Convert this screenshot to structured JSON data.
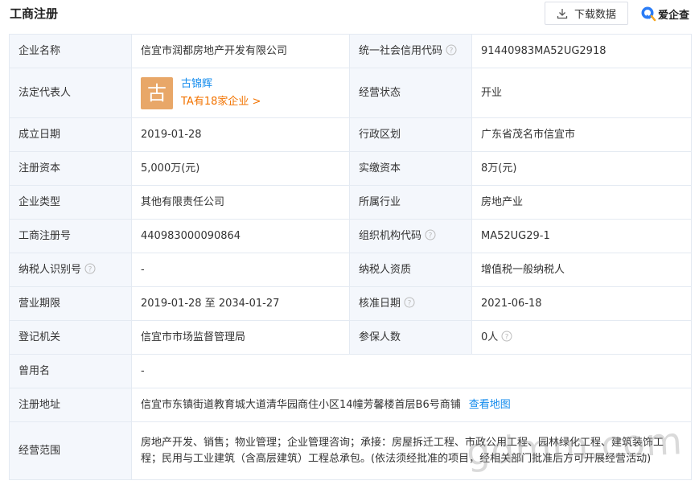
{
  "header": {
    "title": "工商注册",
    "download_label": "下载数据",
    "brand_name": "爱企查"
  },
  "rows": {
    "company_name": {
      "label": "企业名称",
      "value": "信宜市润都房地产开发有限公司"
    },
    "credit_code": {
      "label": "统一社会信用代码",
      "value": "91440983MA52UG2918"
    },
    "legal_rep": {
      "label": "法定代表人",
      "avatar_char": "古",
      "name": "古锦辉",
      "note": "TA有18家企业 >"
    },
    "status": {
      "label": "经营状态",
      "value": "开业"
    },
    "founded": {
      "label": "成立日期",
      "value": "2019-01-28"
    },
    "region": {
      "label": "行政区划",
      "value": "广东省茂名市信宜市"
    },
    "reg_capital": {
      "label": "注册资本",
      "value": "5,000万(元)"
    },
    "paid_capital": {
      "label": "实缴资本",
      "value": "8万(元)"
    },
    "company_type": {
      "label": "企业类型",
      "value": "其他有限责任公司"
    },
    "industry": {
      "label": "所属行业",
      "value": "房地产业"
    },
    "reg_number": {
      "label": "工商注册号",
      "value": "440983000090864"
    },
    "org_code": {
      "label": "组织机构代码",
      "value": "MA52UG29-1"
    },
    "taxpayer_id": {
      "label": "纳税人识别号",
      "value": "-"
    },
    "taxpayer_qual": {
      "label": "纳税人资质",
      "value": "增值税一般纳税人"
    },
    "term": {
      "label": "营业期限",
      "value": "2019-01-28 至 2034-01-27"
    },
    "approval_date": {
      "label": "核准日期",
      "value": "2021-06-18"
    },
    "authority": {
      "label": "登记机关",
      "value": "信宜市市场监督管理局"
    },
    "insured": {
      "label": "参保人数",
      "value": "0人"
    },
    "former_name": {
      "label": "曾用名",
      "value": "-"
    },
    "address": {
      "label": "注册地址",
      "value": "信宜市东镇街道教育城大道清华园商住小区14幢芳馨楼首层B6号商铺",
      "map_link": "查看地图"
    },
    "scope": {
      "label": "经营范围",
      "value": "房地产开发、销售；物业管理；企业管理咨询；承接：房屋拆迁工程、市政公用工程、园林绿化工程、建筑装饰工程；民用与工业建筑（含高层建筑）工程总承包。(依法须经批准的项目，经相关部门批准后方可开展经营活动)"
    }
  },
  "watermark": "gdmm.com",
  "colors": {
    "link": "#128bed",
    "accent_orange": "#f27300",
    "avatar_bg": "#e8a768",
    "label_bg": "#f4f7fc",
    "border": "#e4eaf2"
  }
}
